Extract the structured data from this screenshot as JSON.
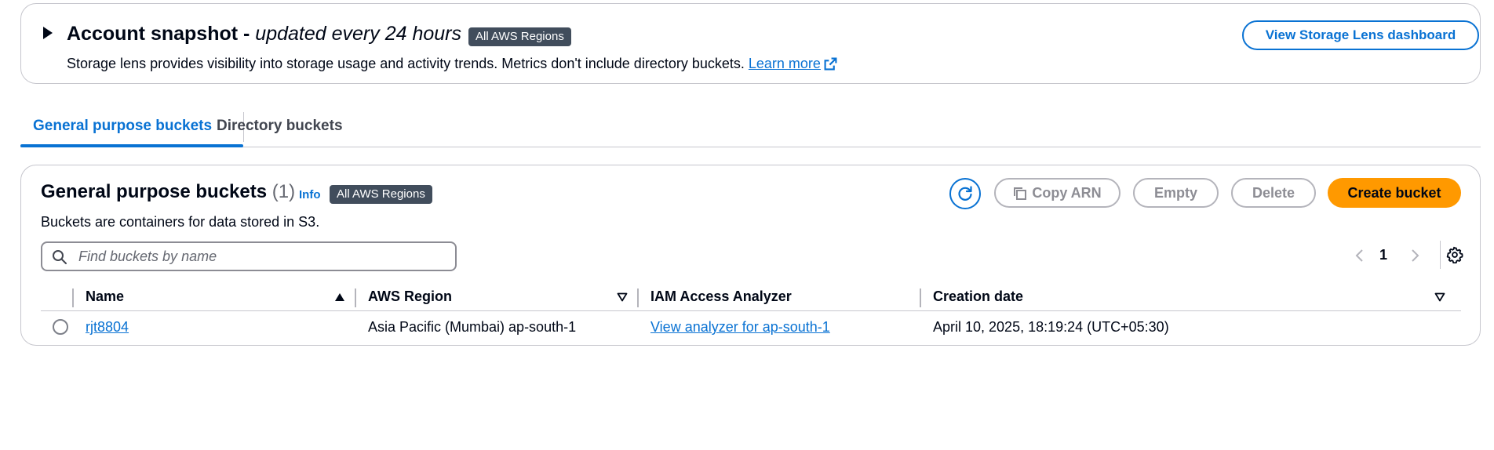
{
  "snapshot": {
    "title_bold": "Account snapshot - ",
    "title_italic": "updated every 24 hours",
    "badge": "All AWS Regions",
    "description": "Storage lens provides visibility into storage usage and activity trends. Metrics don't include directory buckets. ",
    "learn_more": "Learn more",
    "view_dashboard_button": "View Storage Lens dashboard"
  },
  "tabs": [
    {
      "label": "General purpose buckets",
      "active": true
    },
    {
      "label": "Directory buckets",
      "active": false
    }
  ],
  "buckets": {
    "title": "General purpose buckets",
    "count": "(1)",
    "info": "Info",
    "badge": "All AWS Regions",
    "description": "Buckets are containers for data stored in S3.",
    "actions": {
      "copy_arn": "Copy ARN",
      "empty": "Empty",
      "delete": "Delete",
      "create": "Create bucket"
    },
    "search": {
      "placeholder": "Find buckets by name",
      "value": ""
    },
    "pagination": {
      "current_page": "1"
    },
    "columns": [
      "Name",
      "AWS Region",
      "IAM Access Analyzer",
      "Creation date"
    ],
    "rows": [
      {
        "name": "rjt8804",
        "region": "Asia Pacific (Mumbai) ap-south-1",
        "analyzer": "View analyzer for ap-south-1",
        "creation_date": "April 10, 2025, 18:19:24 (UTC+05:30)"
      }
    ]
  },
  "colors": {
    "accent": "#0972d3",
    "primary_button": "#ff9900",
    "badge_bg": "#414d5c",
    "disabled": "#8d8d94"
  },
  "icons": [
    "caret-right-icon",
    "external-link-icon",
    "refresh-icon",
    "copy-icon",
    "search-icon",
    "chevron-left-icon",
    "chevron-right-icon",
    "settings-icon",
    "sort-ascending-icon",
    "sort-icon"
  ]
}
